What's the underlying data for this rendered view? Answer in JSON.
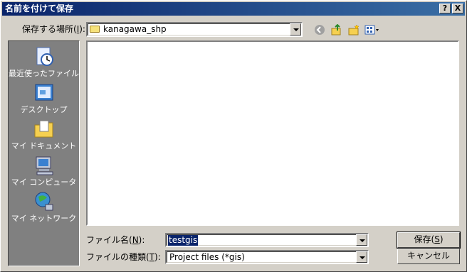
{
  "window": {
    "title": "名前を付けて保存",
    "help_btn": "?",
    "close_btn": "X"
  },
  "location": {
    "label": "保存する場所(",
    "key": "I",
    "label_end": "):",
    "value": "kanagawa_shp"
  },
  "toolbar": {
    "back_icon": "back-icon",
    "up_icon": "up-folder-icon",
    "new_folder_icon": "new-folder-icon",
    "views_icon": "views-menu-icon"
  },
  "places": [
    {
      "label": "最近使ったファイル",
      "icon": "recent-documents-icon"
    },
    {
      "label": "デスクトップ",
      "icon": "desktop-icon"
    },
    {
      "label": "マイ ドキュメント",
      "icon": "my-documents-icon"
    },
    {
      "label": "マイ コンピュータ",
      "icon": "my-computer-icon"
    },
    {
      "label": "マイ ネットワーク",
      "icon": "my-network-icon"
    }
  ],
  "filename": {
    "label": "ファイル名(",
    "key": "N",
    "label_end": "):",
    "value": "testgis"
  },
  "filetype": {
    "label": "ファイルの種類(",
    "key": "T",
    "label_end": "):",
    "value": "Project files (*gis)"
  },
  "buttons": {
    "save_label": "保存(",
    "save_key": "S",
    "save_end": ")",
    "cancel_label": "キャンセル"
  },
  "colors": {
    "titlebar_start": "#0a246a",
    "titlebar_end": "#3a6ea5",
    "face": "#d4d0c8",
    "places_bg": "#808080"
  }
}
